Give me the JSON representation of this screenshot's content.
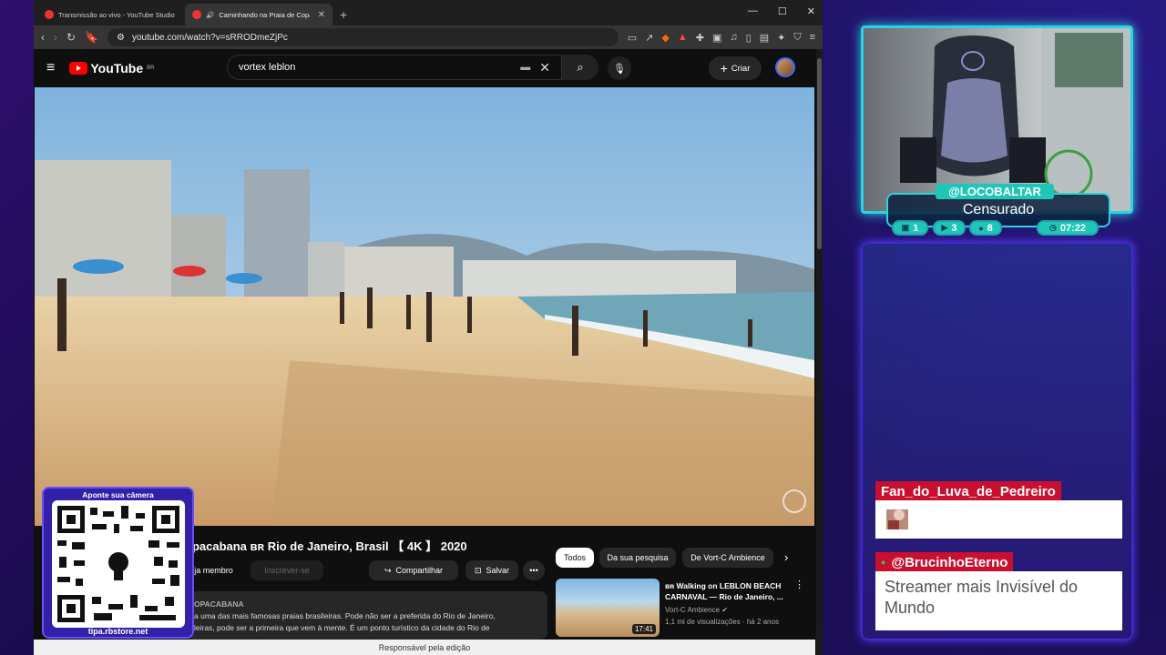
{
  "tabs": [
    {
      "label": "Transmissão ao vivo - YouTube Studio",
      "active": false
    },
    {
      "label": "Caminhando na Praia de Copacabana",
      "active": true
    }
  ],
  "address": {
    "url": "youtube.com/watch?v=sRRODmeZjPc"
  },
  "youtube": {
    "logo": "YouTube",
    "region": "BR",
    "search_value": "vortex leblon",
    "create_label": "Criar"
  },
  "video": {
    "title": "opacabana ʙʀ Rio de Janeiro, Brasil 【 4K 】 2020",
    "member_label": "eja membro",
    "subscribe_label": "Inscrever-se",
    "share_label": "Compartilhar",
    "save_label": "Salvar",
    "desc_channel": "OPACABANA",
    "desc_line1": "a uma das mais famosas praias brasileiras. Pode não ser a preferida do Rio de Janeiro,",
    "desc_line2": "leiras, pode ser a primeira que vem à mente. É um ponto turístico da cidade do Rio de"
  },
  "filters": [
    "Todos",
    "Da sua pesquisa",
    "De Vort-C Ambience"
  ],
  "recommended": {
    "title": "ʙʀ Walking on LEBLON BEACH CARNAVAL — Rio de Janeiro, ...",
    "channel": "Vort-C Ambience ✔",
    "meta": "1,1 mi de visualizações · há 2 anos",
    "duration": "17:41"
  },
  "status_bar": "Responsável pela edição",
  "qr": {
    "top": "Aponte sua câmera",
    "bottom": "tipa.rbstore.net"
  },
  "overlay": {
    "handle": "@LOCOBALTAR",
    "caption": "Censurado",
    "stats": [
      {
        "icon": "twitch-icon",
        "value": "1"
      },
      {
        "icon": "youtube-icon",
        "value": "3"
      },
      {
        "icon": "viewers-icon",
        "value": "8"
      },
      {
        "icon": "clock-icon",
        "value": "07:22"
      }
    ]
  },
  "chat": [
    {
      "user": "Fan_do_Luva_de_Pedreiro",
      "message": ""
    },
    {
      "user": "@BrucinhoEterno",
      "message": "Streamer mais Invisível do Mundo"
    }
  ]
}
